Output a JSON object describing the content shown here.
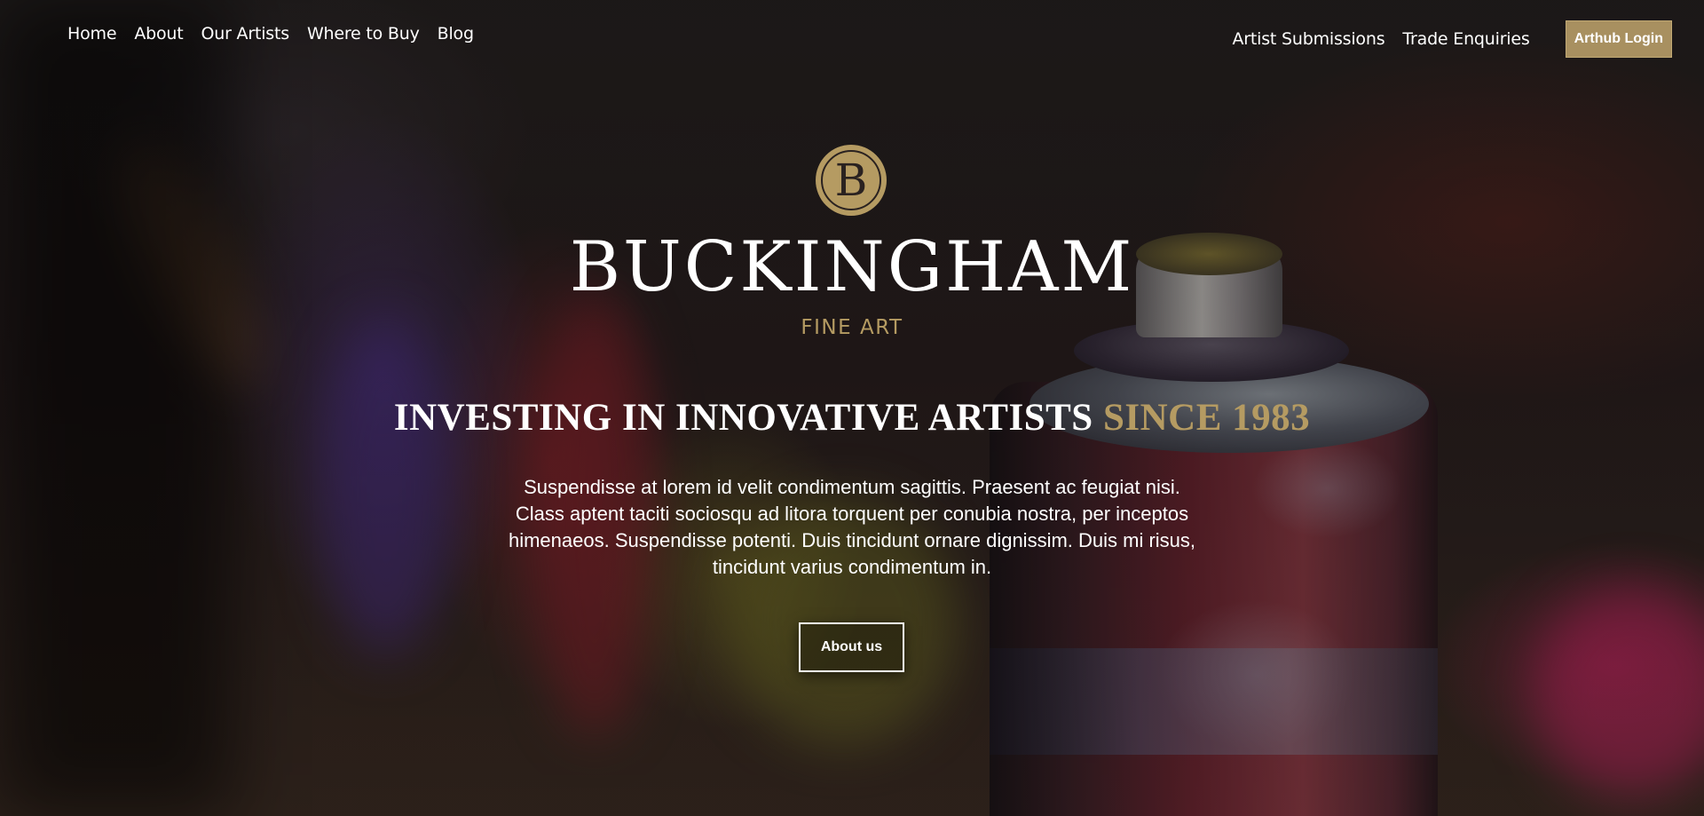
{
  "nav": {
    "left": [
      "Home",
      "About",
      "Our Artists",
      "Where to Buy",
      "Blog"
    ],
    "right": [
      "Artist Submissions",
      "Trade Enquiries"
    ],
    "login_label": "Arthub Login"
  },
  "logo": {
    "monogram": "B",
    "wordmark": "BUCKINGHAM",
    "subtitle": "FINE ART"
  },
  "hero": {
    "headline_main": "INVESTING IN INNOVATIVE ARTISTS",
    "headline_accent": "SINCE 1983",
    "body": "Suspendisse at lorem id velit condimentum sagittis. Praesent ac feugiat nisi. Class aptent taciti sociosqu ad litora torquent per conubia nostra, per inceptos himenaeos. Suspendisse potenti. Duis tincidunt ornare dignissim. Duis mi risus, tincidunt varius condimentum in.",
    "cta_label": "About us"
  },
  "colors": {
    "accent_gold": "#b59b62",
    "button_gold": "#a89060",
    "text": "#ffffff"
  }
}
